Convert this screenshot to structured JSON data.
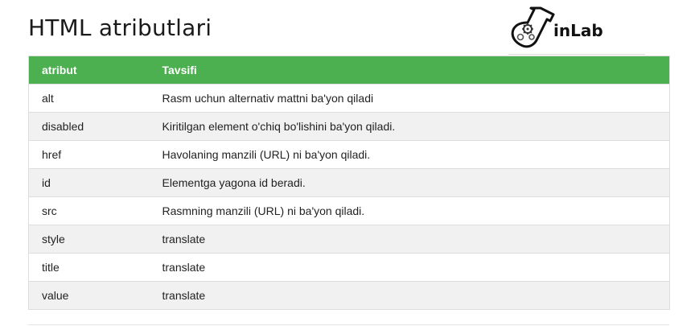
{
  "page": {
    "title": "HTML atributlari"
  },
  "logo": {
    "text": "inLab",
    "icon": "flask-gears-icon"
  },
  "table": {
    "headers": [
      "atribut",
      "Tavsifi"
    ],
    "rows": [
      {
        "attr": "alt",
        "desc": "Rasm uchun alternativ mattni ba'yon qiladi"
      },
      {
        "attr": "disabled",
        "desc": "Kiritilgan element o'chiq bo'lishini ba'yon qiladi."
      },
      {
        "attr": "href",
        "desc": "Havolaning manzili (URL) ni ba'yon qiladi."
      },
      {
        "attr": "id",
        "desc": "Elementga yagona id beradi."
      },
      {
        "attr": "src",
        "desc": "Rasmning manzili (URL) ni ba'yon qiladi."
      },
      {
        "attr": "style",
        "desc": "translate"
      },
      {
        "attr": "title",
        "desc": "translate"
      },
      {
        "attr": "value",
        "desc": "translate"
      }
    ],
    "header_color": "#4caf50",
    "stripe_color": "#f1f1f1"
  }
}
